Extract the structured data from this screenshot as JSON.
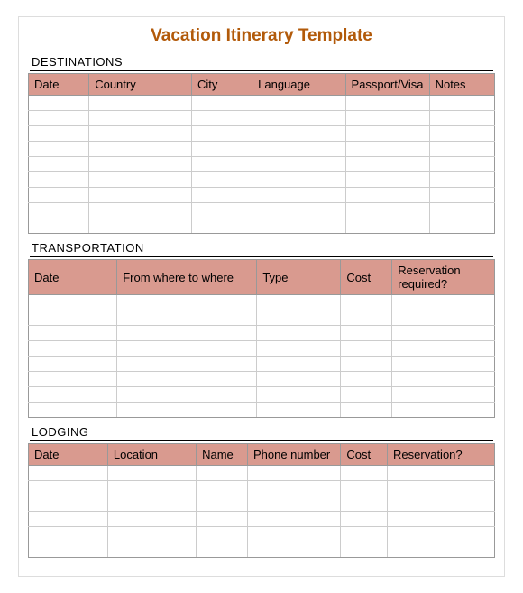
{
  "title": "Vacation Itinerary Template",
  "sections": [
    {
      "label": "DESTINATIONS",
      "columns": [
        "Date",
        "Country",
        "City",
        "Language",
        "Passport/Visa",
        "Notes"
      ],
      "widths": [
        "13%",
        "22%",
        "13%",
        "20%",
        "18%",
        "14%"
      ],
      "rows": 9
    },
    {
      "label": "TRANSPORTATION",
      "columns": [
        "Date",
        "From where to where",
        "Type",
        "Cost",
        "Reservation required?"
      ],
      "widths": [
        "19%",
        "30%",
        "18%",
        "11%",
        "22%"
      ],
      "rows": 8
    },
    {
      "label": "LODGING",
      "columns": [
        "Date",
        "Location",
        "Name",
        "Phone number",
        "Cost",
        "Reservation?"
      ],
      "widths": [
        "17%",
        "19%",
        "11%",
        "20%",
        "10%",
        "23%"
      ],
      "rows": 6
    }
  ]
}
